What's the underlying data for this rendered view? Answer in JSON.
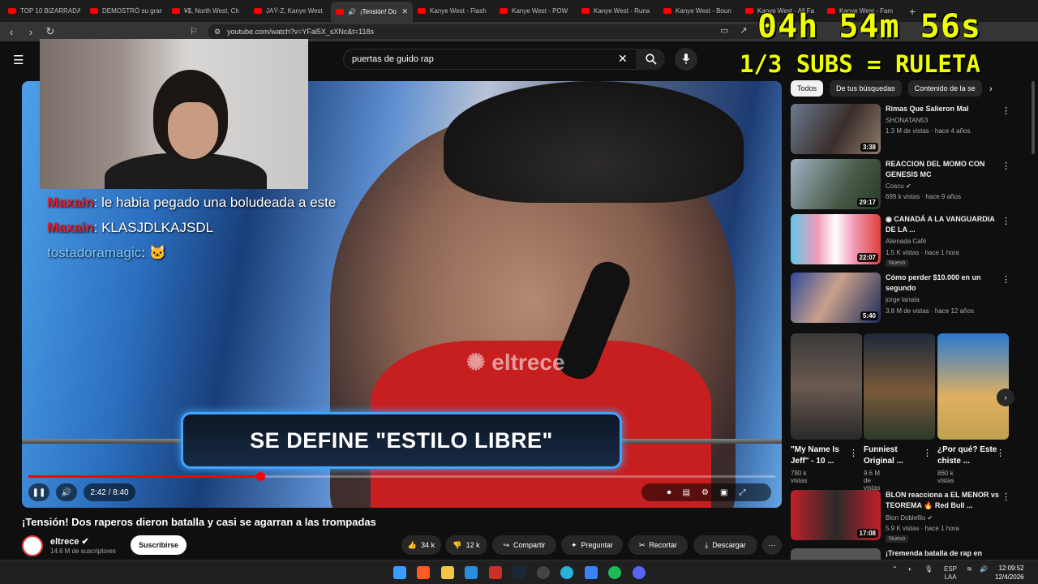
{
  "browser": {
    "tabs": [
      {
        "title": "TOP 10 BIZARRADAS"
      },
      {
        "title": "DEMOSTRÓ su gran"
      },
      {
        "title": "¥$, North West, Ch"
      },
      {
        "title": "JAŸ-Z, Kanye West"
      },
      {
        "title": "¡Tensión! Do"
      },
      {
        "title": "Kanye West - Flash"
      },
      {
        "title": "Kanye West - POW"
      },
      {
        "title": "Kanye West - Runa"
      },
      {
        "title": "Kanye West - Boun"
      },
      {
        "title": "Kanye West - All Fa"
      },
      {
        "title": "Kanye West - Fam"
      }
    ],
    "url": "youtube.com/watch?v=YFal5X_sXNc&t=118s"
  },
  "overlay": {
    "timer": "04h 54m 56s",
    "subs": "1/3 SUBS = RULETA",
    "chat": [
      {
        "user": "Maxain",
        "message": "le habia pegado una boludeada a este"
      },
      {
        "user": "Maxain",
        "message": "KLASJDLKAJSDL"
      },
      {
        "user": "tostadoramagic",
        "message": ""
      }
    ]
  },
  "search": {
    "query": "puertas de guido rap"
  },
  "video": {
    "banner": "SE DEFINE \"ESTILO LIBRE\"",
    "watermark": "eltrece",
    "time": "2:42 / 8:40",
    "progress": 0.31,
    "title": "¡Tensión! Dos raperos dieron batalla y casi se agarran a las trompadas",
    "channel": "eltrece",
    "subscribers": "14.6 M de suscriptores",
    "subscribe_label": "Suscribirse",
    "likes": "34 k",
    "dislikes": "12 k",
    "share": "Compartir",
    "ask": "Preguntar",
    "clip": "Recortar",
    "download": "Descargar"
  },
  "sidebar": {
    "chips": [
      "Todos",
      "De tus búsquedas",
      "Contenido de la se"
    ],
    "recs": [
      {
        "title": "Rimas Que Salieron Mal",
        "channel": "SHONATAN53",
        "meta": "1.3 M de vistas · hace 4 años",
        "duration": "3:38"
      },
      {
        "title": "REACCION DEL MOMO CON GENESIS MC",
        "channel": "Coscu",
        "meta": "699 k vistas · hace 9 años",
        "duration": "29:17"
      },
      {
        "title": "CANADÁ A LA VANGUARDIA DE LA ...",
        "channel": "Alienada Café",
        "meta": "1.5 K vistas · hace 1 hora",
        "duration": "22:07",
        "badge": "Nuevo"
      },
      {
        "title": "Cómo perder $10.000 en un segundo",
        "channel": "jorge lanata",
        "meta": "3.8 M de vistas · hace 12 años",
        "duration": "5:40"
      }
    ],
    "shorts": [
      {
        "title": "\"My Name Is Jeff\" - 10 ...",
        "views": "780 k vistas"
      },
      {
        "title": "Funniest Original ...",
        "views": "9.6 M de vistas"
      },
      {
        "title": "¿Por qué? Este chiste ...",
        "views": "860 k vistas"
      }
    ],
    "recs2": [
      {
        "title": "BLON reacciona a EL MENOR vs TEOREMA 🔥 Red Bull ...",
        "channel": "Blon Doblefilo",
        "meta": "5.9 K vistas · hace 1 hora",
        "duration": "17:08",
        "badge": "Nuevo"
      },
      {
        "title": "¡Tremenda batalla de rap en"
      }
    ]
  },
  "taskbar": {
    "lang": "ESP",
    "region": "LAA",
    "time": "12:09:52",
    "date": "12/4/2026"
  }
}
